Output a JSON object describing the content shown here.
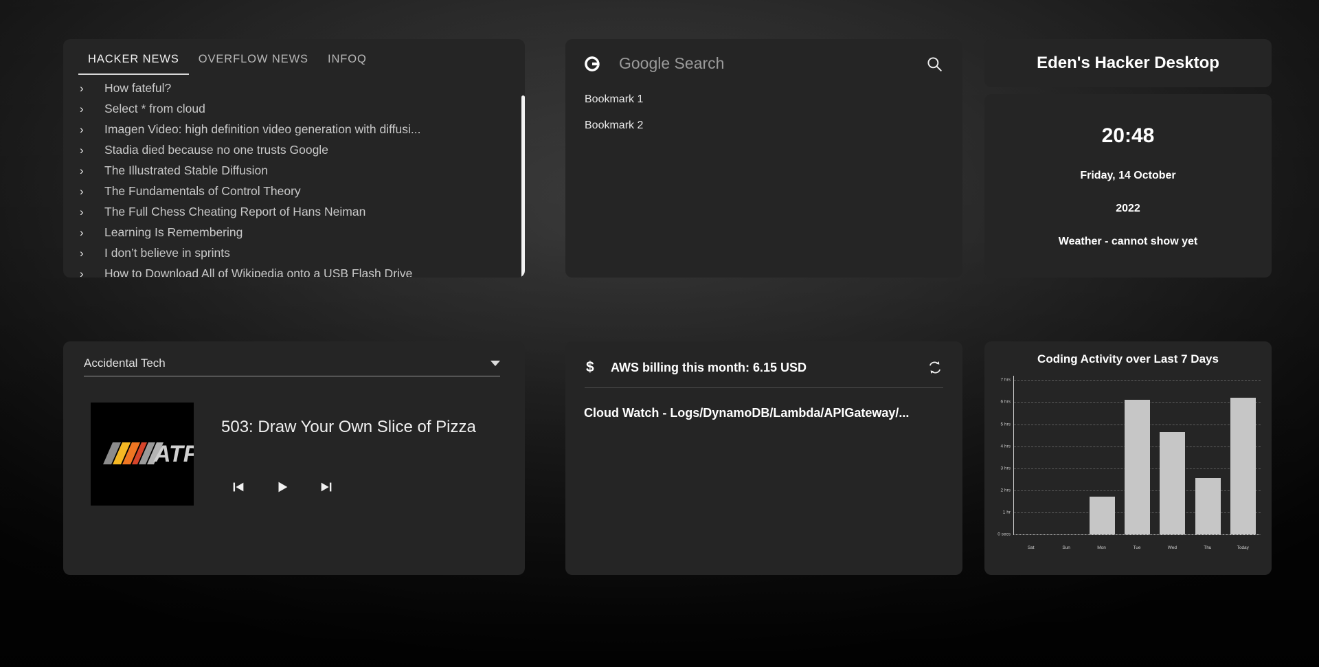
{
  "news": {
    "tabs": [
      {
        "label": "HACKER NEWS",
        "active": true
      },
      {
        "label": "OVERFLOW NEWS",
        "active": false
      },
      {
        "label": "INFOQ",
        "active": false
      }
    ],
    "items": [
      {
        "title": "How fateful?"
      },
      {
        "title": "Select * from cloud"
      },
      {
        "title": "Imagen Video: high definition video generation with diffusi..."
      },
      {
        "title": "Stadia died because no one trusts Google"
      },
      {
        "title": "The Illustrated Stable Diffusion"
      },
      {
        "title": "The Fundamentals of Control Theory"
      },
      {
        "title": "The Full Chess Cheating Report of Hans Neiman"
      },
      {
        "title": "Learning Is Remembering"
      },
      {
        "title": "I don’t believe in sprints"
      },
      {
        "title": "How to Download All of Wikipedia onto a USB Flash Drive"
      }
    ]
  },
  "search": {
    "logo_letter": "G",
    "placeholder": "Google Search",
    "search_icon": "search-icon",
    "bookmarks": [
      {
        "label": "Bookmark 1"
      },
      {
        "label": "Bookmark 2"
      }
    ]
  },
  "title_widget": {
    "text": "Eden's Hacker Desktop"
  },
  "clock": {
    "time": "20:48",
    "date": "Friday, 14 October",
    "year": "2022",
    "weather": "Weather - cannot show yet"
  },
  "podcast": {
    "selected_show": "Accidental Tech",
    "dropdown_icon": "chevron-down-icon",
    "cover_text": "ATP",
    "episode_title": "503: Draw Your Own Slice of Pizza",
    "controls": [
      {
        "name": "previous-track-button",
        "icon": "skip-previous-icon"
      },
      {
        "name": "play-button",
        "icon": "play-icon"
      },
      {
        "name": "next-track-button",
        "icon": "skip-next-icon"
      }
    ]
  },
  "aws": {
    "currency_icon": "dollar-icon",
    "title": "AWS billing this month: 6.15 USD",
    "refresh_icon": "refresh-icon",
    "subtitle": "Cloud Watch - Logs/DynamoDB/Lambda/APIGateway/..."
  },
  "chart_data": {
    "type": "bar",
    "title": "Coding Activity over Last 7 Days",
    "xlabel": "",
    "ylabel": "",
    "categories": [
      "Sat",
      "Sun",
      "Mon",
      "Tue",
      "Wed",
      "Thu",
      "Today"
    ],
    "values": [
      0,
      0,
      1.7,
      6.1,
      4.65,
      2.55,
      6.2
    ],
    "ylim": [
      0,
      7.2
    ],
    "yticks": [
      0,
      1,
      2,
      3,
      4,
      5,
      6,
      7
    ],
    "ytick_labels": [
      "0 secs",
      "1 hr",
      "2 hrs",
      "3 hrs",
      "4 hrs",
      "5 hrs",
      "6 hrs",
      "7 hrs"
    ],
    "grid": true,
    "legend": "none",
    "bar_color": "#c6c6c6"
  },
  "colors": {
    "widget_bg": "#252525",
    "accent": "#d8d8d8",
    "text_primary": "#ffffff",
    "text_secondary": "#c9c9c9"
  }
}
